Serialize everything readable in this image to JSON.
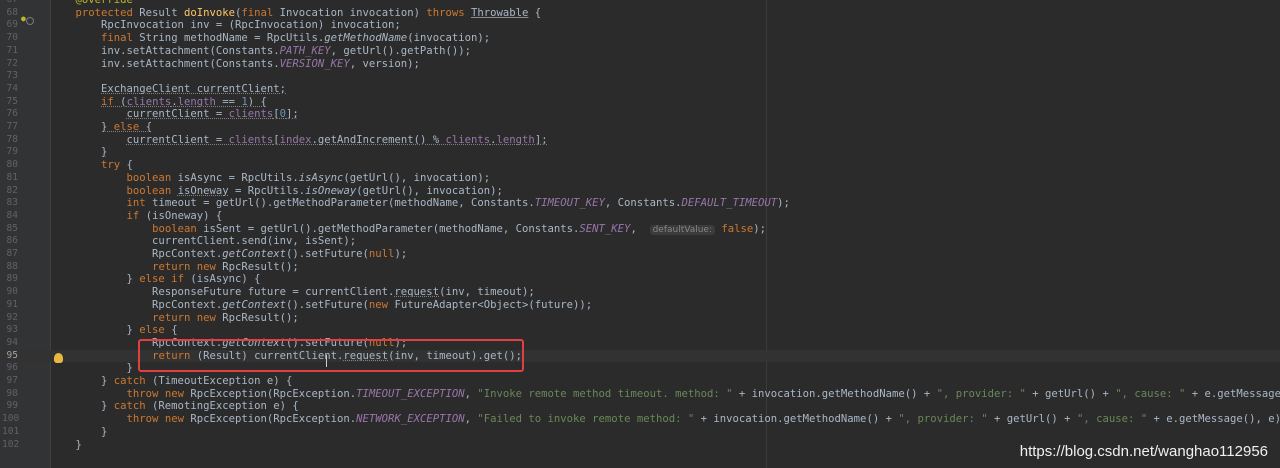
{
  "editor": {
    "colors": {
      "background": "#2b2b2b",
      "gutter": "#313335",
      "keyword": "#cc7832",
      "method": "#ffc66d",
      "constant": "#9876aa",
      "string": "#6a8759",
      "number": "#6897bb",
      "annotation": "#bbb529",
      "highlight_box": "#e04040"
    },
    "current_line": "95",
    "lines": [
      {
        "no": "67",
        "html": "<span class=\"ann\">    @Override</span>"
      },
      {
        "no": "68",
        "html": "    <span class=\"kw\">protected</span> Result <span class=\"fn\">doInvoke</span>(<span class=\"kw\">final</span> Invocation invocation) <span class=\"kw\">throws</span> <span class=\"ul-wavy\">Throwable</span> {"
      },
      {
        "no": "69",
        "html": "        RpcInvocation inv = (RpcInvocation) invocation;"
      },
      {
        "no": "70",
        "html": "        <span class=\"kw\">final</span> String methodName = RpcUtils.<span class=\"it\">getMethodName</span>(invocation);"
      },
      {
        "no": "71",
        "html": "        inv.setAttachment(Constants.<span class=\"cst\">PATH_KEY</span>, getUrl().getPath());"
      },
      {
        "no": "72",
        "html": "        inv.setAttachment(Constants.<span class=\"cst\">VERSION_KEY</span>, version);"
      },
      {
        "no": "73",
        "html": ""
      },
      {
        "no": "74",
        "html": "        <span class=\"u\">ExchangeClient currentClient;</span>"
      },
      {
        "no": "75",
        "html": "        <span class=\"u\"><span class=\"kw\">if</span> (<span class=\"fld\">clients</span>.<span class=\"fld\">length</span> == <span class=\"num\">1</span>) {</span>"
      },
      {
        "no": "76",
        "html": "            <span class=\"u\">currentClient = <span class=\"fld\">clients</span>[<span class=\"num\">0</span>];</span>"
      },
      {
        "no": "77",
        "html": "        <span class=\"u\">} <span class=\"kw\">else</span> {</span>"
      },
      {
        "no": "78",
        "html": "            <span class=\"u\">currentClient = <span class=\"fld\">clients</span>[<span class=\"fld\">index</span>.getAndIncrement() % <span class=\"fld\">clients</span>.<span class=\"fld\">length</span>];</span>"
      },
      {
        "no": "79",
        "html": "        <span class=\"u\">}</span>"
      },
      {
        "no": "80",
        "html": "        <span class=\"kw\">try</span> {"
      },
      {
        "no": "81",
        "html": "            <span class=\"kw\">boolean</span> isAsync = RpcUtils.<span class=\"it\">isAsync</span>(getUrl(), invocation);"
      },
      {
        "no": "82",
        "html": "            <span class=\"kw\">boolean</span> <span class=\"u\">isOneway</span> = RpcUtils.<span class=\"it\">isOneway</span>(getUrl(), invocation);"
      },
      {
        "no": "83",
        "html": "            <span class=\"kw\">int</span> timeout = getUrl().getMethodParameter(methodName, Constants.<span class=\"cst\">TIMEOUT_KEY</span>, Constants.<span class=\"cst\">DEFAULT_TIMEOUT</span>);"
      },
      {
        "no": "84",
        "html": "            <span class=\"kw\">if</span> (isOneway) {"
      },
      {
        "no": "85",
        "html": "                <span class=\"kw\">boolean</span> isSent = getUrl().getMethodParameter(methodName, Constants.<span class=\"cst\">SENT_KEY</span>,  <span class=\"hint\">defaultValue:</span> <span class=\"kw\">false</span>);"
      },
      {
        "no": "86",
        "html": "                currentClient.send(inv, isSent);"
      },
      {
        "no": "87",
        "html": "                RpcContext.<span class=\"it\">getContext</span>().setFuture(<span class=\"kw\">null</span>);"
      },
      {
        "no": "88",
        "html": "                <span class=\"kw\">return new</span> RpcResult();"
      },
      {
        "no": "89",
        "html": "            } <span class=\"kw\">else if</span> (isAsync) {"
      },
      {
        "no": "90",
        "html": "                ResponseFuture future = currentClient.<span class=\"u\">request</span>(inv, timeout);"
      },
      {
        "no": "91",
        "html": "                RpcContext.<span class=\"it\">getContext</span>().setFuture(<span class=\"kw\">new</span> FutureAdapter&lt;Object&gt;(future));"
      },
      {
        "no": "92",
        "html": "                <span class=\"kw\">return new</span> RpcResult();"
      },
      {
        "no": "93",
        "html": "            } <span class=\"kw\">else</span> {"
      },
      {
        "no": "94",
        "html": "                RpcContext.<span class=\"it\">getContext</span>().setFuture(<span class=\"kw\">null</span>);"
      },
      {
        "no": "95",
        "html": "                <span class=\"kw\">return</span> (Result) currentClient.<span class=\"u\">request</span>(inv, timeout).get();"
      },
      {
        "no": "96",
        "html": "            }"
      },
      {
        "no": "97",
        "html": "        } <span class=\"kw\">catch</span> (TimeoutException e) {"
      },
      {
        "no": "98",
        "html": "            <span class=\"kw\">throw new</span> RpcException(RpcException.<span class=\"cst\">TIMEOUT_EXCEPTION</span>, <span class=\"str\">\"Invoke remote method timeout. method: \"</span> + invocation.getMethodName() + <span class=\"str\">\", provider: \"</span> + getUrl() + <span class=\"str\">\", cause: \"</span> + e.getMessage(), e);"
      },
      {
        "no": "99",
        "html": "        } <span class=\"kw\">catch</span> (RemotingException e) {"
      },
      {
        "no": "100",
        "html": "            <span class=\"kw\">throw new</span> RpcException(RpcException.<span class=\"cst\">NETWORK_EXCEPTION</span>, <span class=\"str\">\"Failed to invoke remote method: \"</span> + invocation.getMethodName() + <span class=\"str\">\", provider: \"</span> + getUrl() + <span class=\"str\">\", cause: \"</span> + e.getMessage(), e);"
      },
      {
        "no": "101",
        "html": "        }"
      },
      {
        "no": "102",
        "html": "    }"
      }
    ]
  },
  "watermark": "https://blog.csdn.net/wanghao112956"
}
